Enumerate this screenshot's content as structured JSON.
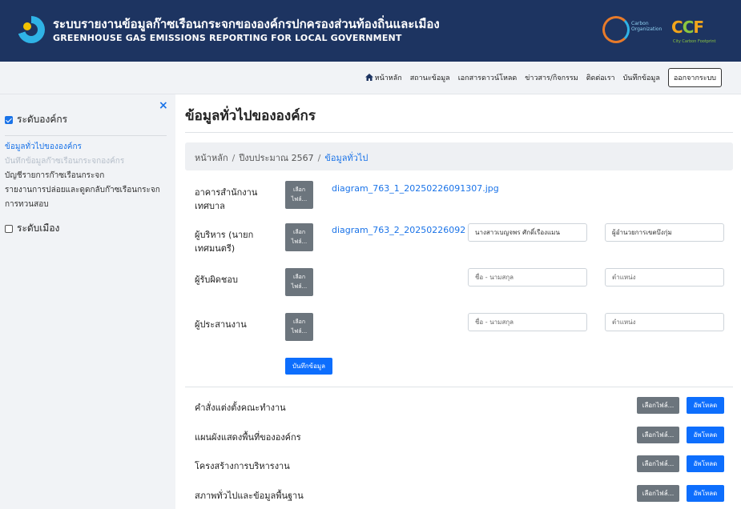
{
  "header": {
    "title_th": "ระบบรายงานข้อมูลก๊าซเรือนกระจกขององค์กรปกครองส่วนท้องถิ่นและเมือง",
    "title_en": "GREENHOUSE GAS EMISSIONS REPORTING FOR LOCAL GOVERNMENT",
    "badge_org_text": "Carbon Organization",
    "badge_ccf_c1": "C",
    "badge_ccf_c2": "C",
    "badge_ccf_f": "F",
    "badge_ccf_sub": "City Carbon Footprint"
  },
  "nav": {
    "items": [
      "หน้าหลัก",
      "สถานะข้อมูล",
      "เอกสารดาวน์โหลด",
      "ข่าวสาร/กิจกรรม",
      "ติดต่อเรา",
      "บันทึกข้อมูล"
    ],
    "logout": "ออกจากระบบ"
  },
  "sidebar": {
    "close": "×",
    "org_level": "ระดับองค์กร",
    "links": [
      "ข้อมูลทั่วไปขององค์กร",
      "บันทึกข้อมูลก๊าซเรือนกระจกองค์กร",
      "บัญชีรายการก๊าซเรือนกระจก",
      "รายงานการปล่อยและดูดกลับก๊าซเรือนกระจก",
      "การทวนสอบ"
    ],
    "city_level": "ระดับเมือง"
  },
  "main": {
    "title": "ข้อมูลทั่วไปขององค์กร",
    "breadcrumb": [
      "หน้าหลัก",
      "ปีงบประมาณ 2567",
      "ข้อมูลทั่วไป"
    ],
    "choose_file_line1": "เลือก",
    "choose_file_line2": "ไฟล์...",
    "rows": [
      {
        "label": "อาคารสำนักงานเทศบาล",
        "file": "diagram_763_1_20250226091307.jpg"
      },
      {
        "label": "ผู้บริหาร (นายกเทศมนตรี)",
        "file": "diagram_763_2_20250226092",
        "name_value": "นางสาวเบญจพร ศักดิ์เรืองแมน",
        "position_value": "ผู้อำนวยการเขตบึงกุ่ม"
      },
      {
        "label": "ผู้รับผิดชอบ",
        "name_placeholder": "ชื่อ - นามสกุล",
        "position_placeholder": "ตำแหน่ง"
      },
      {
        "label": "ผู้ประสานงาน",
        "name_placeholder": "ชื่อ - นามสกุล",
        "position_placeholder": "ตำแหน่ง"
      }
    ],
    "save_label": "บันทึกข้อมูล",
    "documents": [
      "คำสั่งแต่งตั้งคณะทำงาน",
      "แผนผังแสดงพื้นที่ขององค์กร",
      "โครงสร้างการบริหารงาน",
      "สภาพทั่วไปและข้อมูลพื้นฐาน"
    ],
    "doc_choose_label": "เลือกไฟล์...",
    "doc_upload_label": "อัพโหลด"
  },
  "colors": {
    "header_bg": "#1d3461",
    "accent": "#1a73e8",
    "primary_button": "#0d6efd",
    "secondary_button": "#6c757d"
  }
}
